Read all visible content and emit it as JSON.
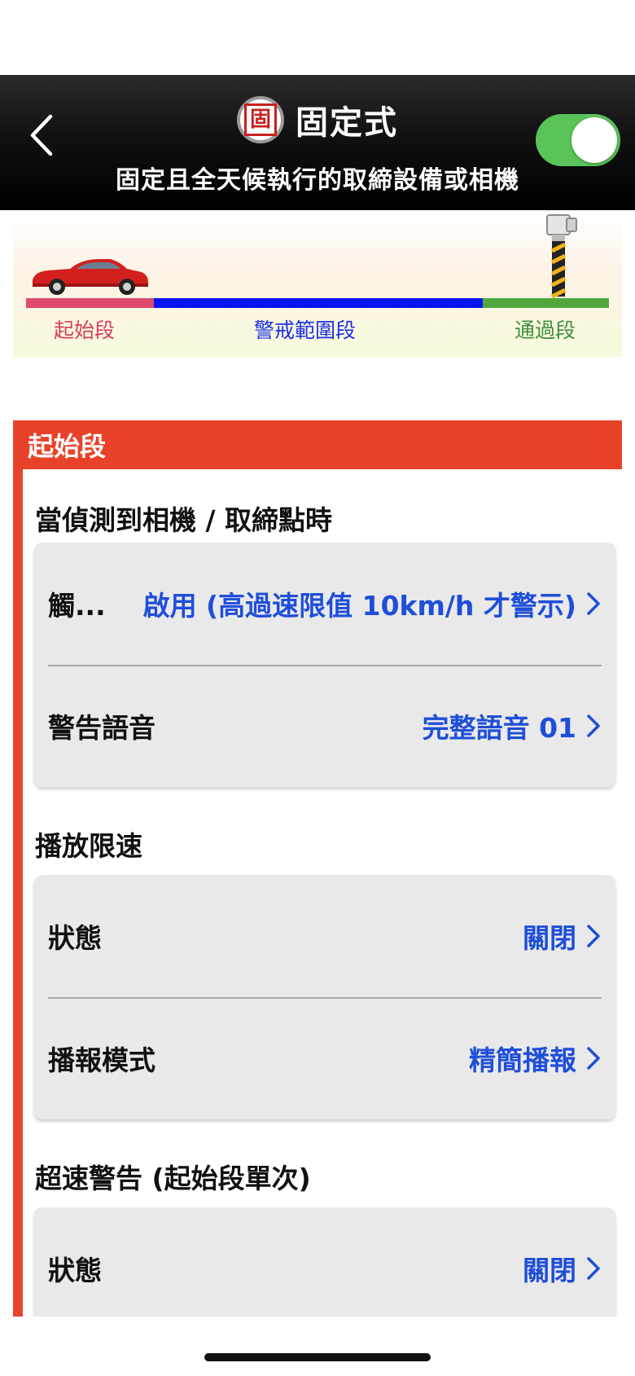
{
  "header": {
    "badge_char": "固",
    "title": "固定式",
    "subtitle": "固定且全天候執行的取締設備或相機",
    "toggle_on": true,
    "toggle_color": "#5ac35a"
  },
  "diagram": {
    "segments": {
      "start": "起始段",
      "warning": "警戒範圍段",
      "pass": "通過段"
    },
    "colors": {
      "start": "#e04a6e",
      "warning": "#0a14f0",
      "pass": "#50a83c"
    }
  },
  "section": {
    "title": "起始段",
    "accent": "#e8432a",
    "groups": [
      {
        "title": "當偵測到相機 / 取締點時",
        "rows": [
          {
            "label": "觸...",
            "value": "啟用 (高過速限值 10km/h 才警示)"
          },
          {
            "label": "警告語音",
            "value": "完整語音 01"
          }
        ]
      },
      {
        "title": "播放限速",
        "rows": [
          {
            "label": "狀態",
            "value": "關閉"
          },
          {
            "label": "播報模式",
            "value": "精簡播報"
          }
        ]
      },
      {
        "title": "超速警告 (起始段單次)",
        "rows": [
          {
            "label": "狀態",
            "value": "關閉"
          }
        ]
      }
    ]
  },
  "icons": {
    "back": "chevron-left-icon",
    "row_arrow": "chevron-right-icon",
    "link_color": "#1f4ed8"
  }
}
